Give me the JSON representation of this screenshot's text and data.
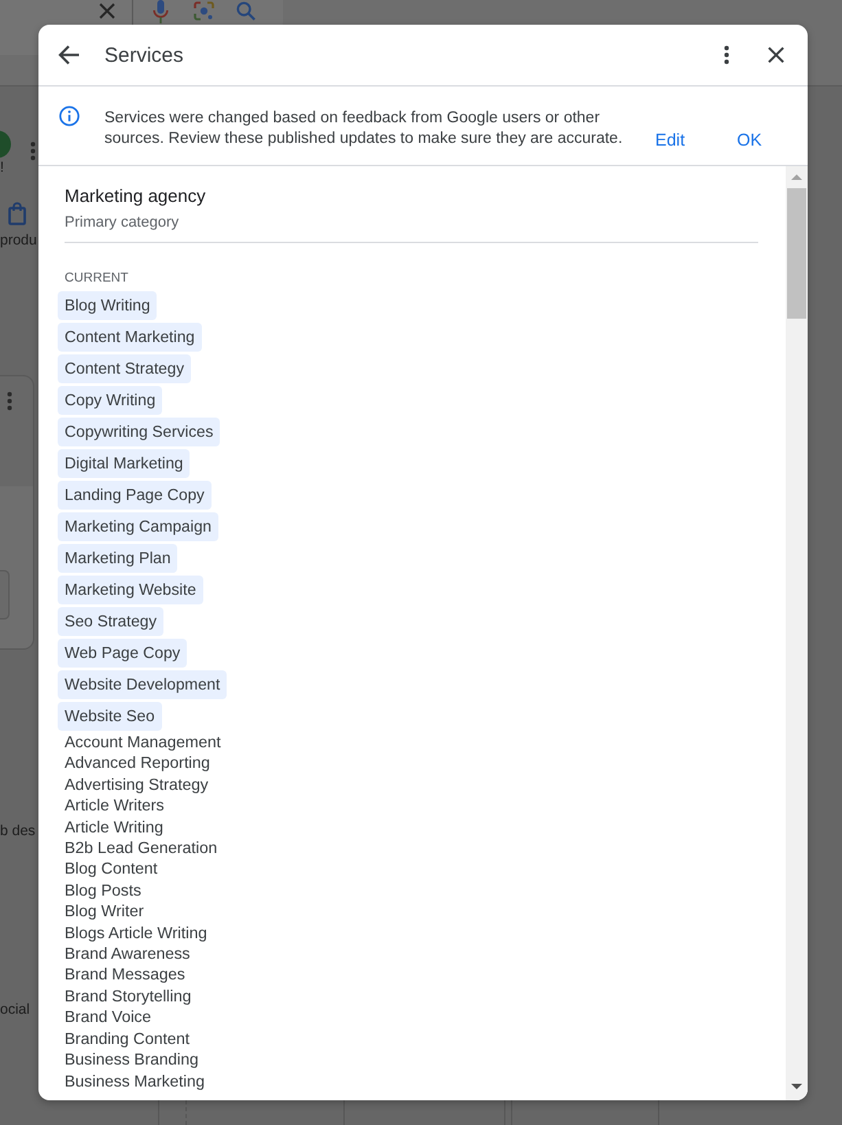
{
  "background_page": {
    "left_edge_texts": [
      "!",
      "produ",
      "b des",
      "ocial"
    ]
  },
  "dialog": {
    "title": "Services",
    "notice": {
      "message": "Services were changed based on feedback from Google users or other sources. Review these published updates to make sure they are accurate.",
      "actions": [
        "Edit",
        "OK"
      ]
    },
    "category": {
      "name": "Marketing agency",
      "label": "Primary category"
    },
    "current_services": {
      "heading": "CURRENT",
      "items": [
        "Blog Writing",
        "Content Marketing",
        "Content Strategy",
        "Copy Writing",
        "Copywriting Services",
        "Digital Marketing",
        "Landing Page Copy",
        "Marketing Campaign",
        "Marketing Plan",
        "Marketing Website",
        "Seo Strategy",
        "Web Page Copy",
        "Website Development",
        "Website Seo"
      ]
    },
    "other_services": [
      "Account Management",
      "Advanced Reporting",
      "Advertising Strategy",
      "Article Writers",
      "Article Writing",
      "B2b Lead Generation",
      "Blog Content",
      "Blog Posts",
      "Blog Writer",
      "Blogs Article Writing",
      "Brand Awareness",
      "Brand Messages",
      "Brand Storytelling",
      "Brand Voice",
      "Branding Content",
      "Business Branding",
      "Business Marketing"
    ]
  }
}
